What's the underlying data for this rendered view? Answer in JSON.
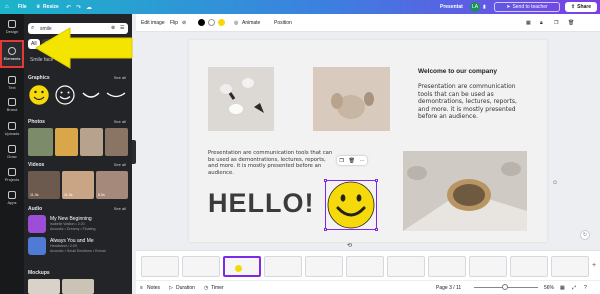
{
  "topbar": {
    "file": "File",
    "resize": "Resize",
    "presentation_label": "Presentat",
    "avatar_initials": "LA",
    "send_teacher": "Send to teacher",
    "share": "Share"
  },
  "rail": {
    "items": [
      {
        "label": "Design"
      },
      {
        "label": "Elements"
      },
      {
        "label": "Text"
      },
      {
        "label": "Brand"
      },
      {
        "label": "Uploads"
      },
      {
        "label": "Draw"
      },
      {
        "label": "Projects"
      },
      {
        "label": "Apps"
      }
    ]
  },
  "panel": {
    "search_value": "smile",
    "chips": [
      "All",
      "Graphics"
    ],
    "suggestion": "Smile face",
    "graphics_title": "Graphics",
    "photos_title": "Photos",
    "videos_title": "Videos",
    "audio_title": "Audio",
    "mockups_title": "Mockups",
    "see_all": "See all",
    "videos": [
      {
        "duration": "11.0s"
      },
      {
        "duration": "11.0s"
      },
      {
        "duration": "8.0s"
      }
    ],
    "audio": [
      {
        "title": "My New Beginning",
        "sub1": "Isabelle Walton • 2:20",
        "sub2": "Acoustic • Dreamy • Floating"
      },
      {
        "title": "Always You and Me",
        "sub1": "Headband • 2:09",
        "sub2": "Acoustic • Small Emotions • Romar"
      }
    ]
  },
  "toolbar": {
    "edit_image": "Edit image",
    "flip": "Flip",
    "animate": "Animate",
    "position": "Position"
  },
  "slide": {
    "title": "Welcome to our company",
    "paragraph_right": "Presentation are communication tools that can be used as demontrations, lectures, reports, and more. it is mostly presented before an audience.",
    "paragraph_left": "Presentation are communication tools that can be used as demontrations, lectures, reports, and more. it is mostly presented before an audience.",
    "hello": "HELLO!"
  },
  "footer": {
    "notes": "Notes",
    "duration": "Duration",
    "timer": "Timer",
    "page": "Page 3 / 11",
    "zoom": "56%"
  },
  "colors": {
    "accent": "#7d2ae8",
    "smiley": "#f5d90a",
    "arrow": "#f3e500",
    "highlight": "#e53935"
  }
}
